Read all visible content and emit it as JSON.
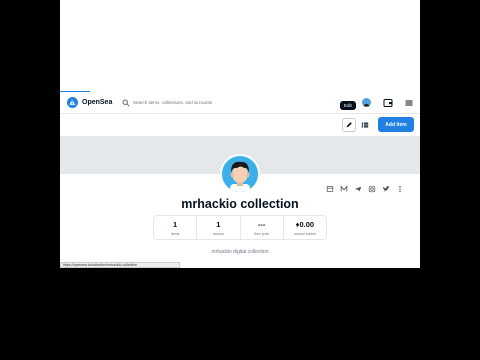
{
  "nav": {
    "brand": "OpenSea",
    "search_placeholder": "Search items, collections, and accounts"
  },
  "tooltip": {
    "edit": "Edit"
  },
  "toolbar": {
    "add_item_label": "Add item"
  },
  "collection": {
    "title": "mrhackio collection",
    "description": "mrhackio digital collection",
    "stats": [
      {
        "value": "1",
        "label": "items"
      },
      {
        "value": "1",
        "label": "owners"
      },
      {
        "value": "---",
        "label": "floor price"
      },
      {
        "value": "♦0.00",
        "label": "volume traded"
      }
    ]
  },
  "status_url": "https://opensea.io/collection/mrhackio-collection",
  "icons": {
    "nav": [
      "opensea-logo-icon",
      "search-icon",
      "wallet-icon",
      "menu-icon"
    ],
    "toolbar": [
      "edit-icon",
      "list-icon"
    ],
    "socials": [
      "activity-icon",
      "medium-icon",
      "telegram-icon",
      "instagram-icon",
      "twitter-icon",
      "more-icon"
    ]
  },
  "colors": {
    "accent": "#2081e2",
    "avatar_bg": "#3bb0e8",
    "banner": "#e5e8eb",
    "text": "#04111d"
  }
}
